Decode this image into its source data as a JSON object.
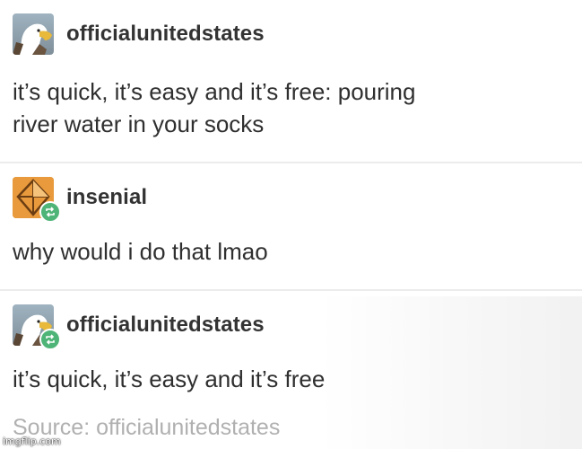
{
  "posts": [
    {
      "username": "officialunitedstates",
      "avatar_icon": "eagle-icon",
      "reblog": false,
      "text_lines": [
        "it’s quick, it’s easy and it’s free: pouring",
        "river water in your socks"
      ]
    },
    {
      "username": "insenial",
      "avatar_icon": "kite-icon",
      "reblog": true,
      "text_lines": [
        "why would i do that lmao"
      ]
    },
    {
      "username": "officialunitedstates",
      "avatar_icon": "eagle-icon",
      "reblog": true,
      "text_lines": [
        "it’s quick, it’s easy and it’s free"
      ]
    }
  ],
  "source": "Source: officialunitedstates",
  "watermark": "imgflip.com",
  "colors": {
    "reblog_badge": "#4fb477",
    "kite_avatar": "#e89a3c"
  }
}
